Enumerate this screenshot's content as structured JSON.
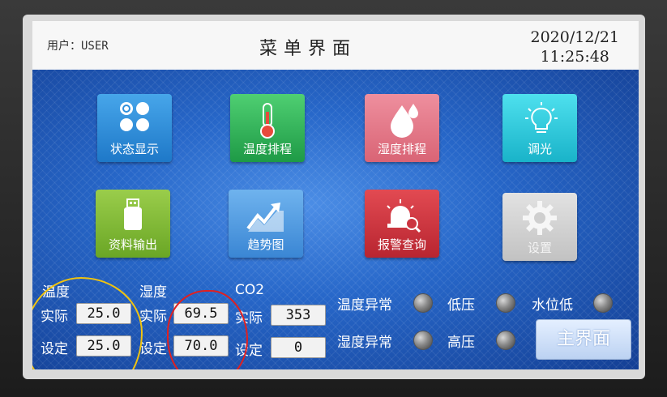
{
  "header": {
    "user": "用户：USER",
    "title": "菜单界面",
    "date": "2020/12/21",
    "time": "11:25:48"
  },
  "menu": [
    {
      "label": "状态显示",
      "icon": "four-circles-icon",
      "color": "#2f8fdc"
    },
    {
      "label": "温度排程",
      "icon": "thermometer-icon",
      "color": "#2fb65a"
    },
    {
      "label": "湿度排程",
      "icon": "water-drops-icon",
      "color": "#e27a8a"
    },
    {
      "label": "调光",
      "icon": "light-bulb-icon",
      "color": "#2ccbdc"
    },
    {
      "label": "资料输出",
      "icon": "usb-drive-icon",
      "color": "#82ba38"
    },
    {
      "label": "趋势图",
      "icon": "trend-chart-icon",
      "color": "#4f9ce2"
    },
    {
      "label": "报警查询",
      "icon": "alarm-search-icon",
      "color": "#cc3540"
    },
    {
      "label": "设置",
      "icon": "gear-icon",
      "color": "#d2d2d2"
    }
  ],
  "readings": {
    "temperature": {
      "title": "温度",
      "actual_label": "实际",
      "actual": "25.0",
      "set_label": "设定",
      "set": "25.0"
    },
    "humidity": {
      "title": "湿度",
      "actual_label": "实际",
      "actual": "69.5",
      "set_label": "设定",
      "set": "70.0"
    },
    "co2": {
      "title": "CO2",
      "actual_label": "实际",
      "actual": "353",
      "set_label": "设定",
      "set": "0"
    }
  },
  "status": {
    "temp_abnormal": "温度异常",
    "humidity_abnormal": "湿度异常",
    "low_pressure": "低压",
    "high_pressure": "高压",
    "low_water": "水位低"
  },
  "main_button": "主界面",
  "annotation_colors": {
    "yellow": "#f1c40f",
    "red": "#e02020"
  }
}
